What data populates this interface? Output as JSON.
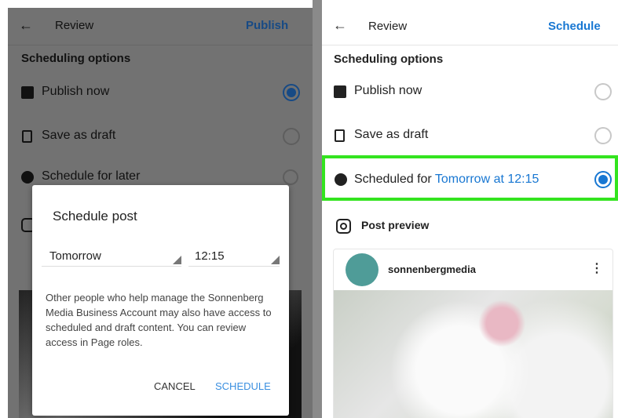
{
  "left": {
    "header": {
      "title": "Review",
      "action": "Publish"
    },
    "section": "Scheduling options",
    "options": [
      {
        "label": "Publish now",
        "icon": "article-icon",
        "selected": true
      },
      {
        "label": "Save as draft",
        "icon": "draft-icon",
        "selected": false
      },
      {
        "label": "Schedule for later",
        "icon": "clock-icon",
        "selected": false
      }
    ],
    "dialog": {
      "title": "Schedule post",
      "date": "Tomorrow",
      "time": "12:15",
      "body": "Other people who help manage the Sonnenberg Media Business Account may also have access to scheduled and draft content. You can review access in Page roles.",
      "cancel": "CANCEL",
      "confirm": "SCHEDULE"
    }
  },
  "right": {
    "header": {
      "title": "Review",
      "action": "Schedule"
    },
    "section": "Scheduling options",
    "options": [
      {
        "label": "Publish now",
        "icon": "article-icon",
        "selected": false
      },
      {
        "label": "Save as draft",
        "icon": "draft-icon",
        "selected": false
      },
      {
        "label_prefix": "Scheduled for ",
        "label_value": "Tomorrow at 12:15",
        "icon": "clock-icon",
        "selected": true
      }
    ],
    "preview": {
      "title": "Post preview",
      "account": "sonnenbergmedia"
    }
  },
  "colors": {
    "accent": "#1877d2",
    "highlight": "#33e41f"
  }
}
